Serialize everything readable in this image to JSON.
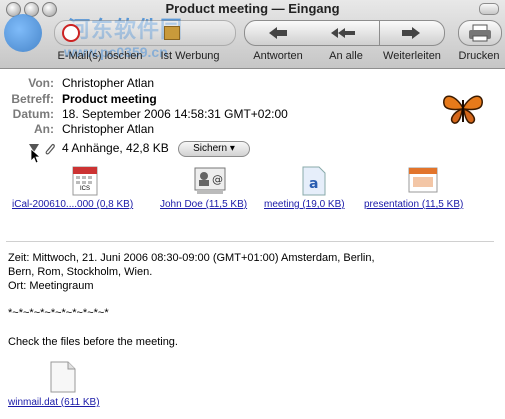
{
  "window": {
    "title": "Product meeting — Eingang"
  },
  "watermark": {
    "cn": "河东软件园",
    "url": "www.pc0359.cn"
  },
  "toolbar": {
    "delete_label": "E-Mail(s) löschen",
    "junk_label": "Ist Werbung",
    "reply_label": "Antworten",
    "reply_all_label": "An alle",
    "forward_label": "Weiterleiten",
    "print_label": "Drucken"
  },
  "header": {
    "from_label": "Von:",
    "from_value": "Christopher Atlan",
    "subject_label": "Betreff:",
    "subject_value": "Product meeting",
    "date_label": "Datum:",
    "date_value": "18. September 2006 14:58:31 GMT+02:00",
    "to_label": "An:",
    "to_value": "Christopher Atlan"
  },
  "attachments": {
    "summary": "4 Anhänge, 42,8 KB",
    "save_label": "Sichern",
    "items": [
      {
        "name": "iCal-200610....000 (0,8 KB)",
        "badge": "ICS"
      },
      {
        "name": "John Doe (11,5 KB)",
        "badge": ""
      },
      {
        "name": "meeting (19,0 KB)",
        "badge": ""
      },
      {
        "name": "presentation (11,5 KB)",
        "badge": ""
      }
    ]
  },
  "body": {
    "line1": "Zeit: Mittwoch, 21. Juni 2006 08:30-09:00 (GMT+01:00) Amsterdam, Berlin,",
    "line2": "Bern, Rom, Stockholm, Wien.",
    "line3": "Ort: Meetingraum",
    "line4": "*~*~*~*~*~*~*~*~*~*",
    "line5": "Check the files before the meeting.",
    "inline_attachment": "winmail.dat (611 KB)"
  }
}
